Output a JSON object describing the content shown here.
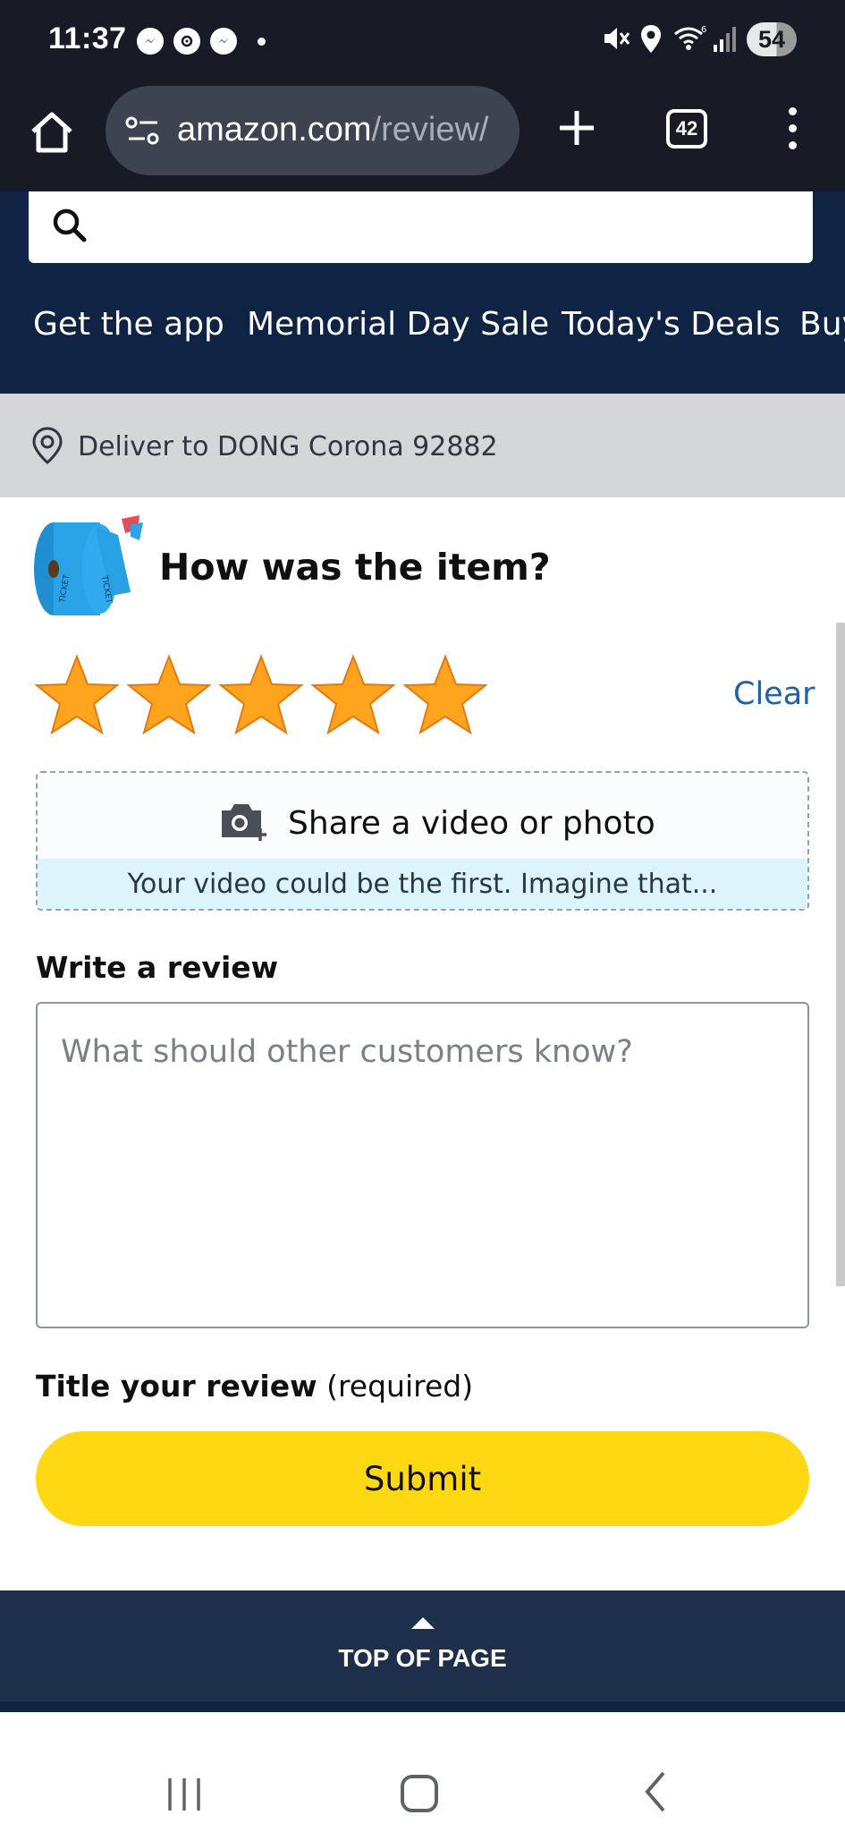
{
  "status_bar": {
    "time": "11:37",
    "battery": "54"
  },
  "browser": {
    "url_domain": "amazon.com",
    "url_path": "/review/",
    "tab_count": "42"
  },
  "header": {
    "nav_links": [
      "Get the app",
      "Memorial Day Sale",
      "Today's Deals",
      "Buy"
    ]
  },
  "delivery": {
    "text": "Deliver to DONG Corona 92882"
  },
  "review": {
    "question": "How was the item?",
    "rating": 5,
    "max_rating": 5,
    "star_color": "#ffa41c",
    "clear_label": "Clear",
    "upload_label": "Share a video or photo",
    "upload_sub": "Your video could be the first. Imagine that...",
    "write_heading": "Write a review",
    "textarea_placeholder": "What should other customers know?",
    "title_heading": "Title your review",
    "title_required": "(required)",
    "submit_label": "Submit",
    "submit_color": "#ffd814"
  },
  "footer": {
    "top_of_page": "TOP OF PAGE"
  },
  "icons": {
    "status_notifications": [
      "messenger-icon",
      "threads-icon",
      "messenger-icon"
    ],
    "status_right": [
      "mute-icon",
      "location-icon",
      "wifi-icon",
      "signal-icon"
    ]
  }
}
